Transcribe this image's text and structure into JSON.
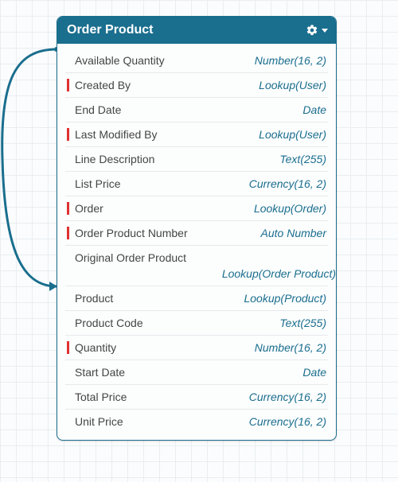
{
  "panel": {
    "title": "Order Product"
  },
  "fields": [
    {
      "name": "Available Quantity",
      "type": "Number(16, 2)",
      "required": false,
      "wrap": false
    },
    {
      "name": "Created By",
      "type": "Lookup(User)",
      "required": true,
      "wrap": false
    },
    {
      "name": "End Date",
      "type": "Date",
      "required": false,
      "wrap": false
    },
    {
      "name": "Last Modified By",
      "type": "Lookup(User)",
      "required": true,
      "wrap": false
    },
    {
      "name": "Line Description",
      "type": "Text(255)",
      "required": false,
      "wrap": false
    },
    {
      "name": "List Price",
      "type": "Currency(16, 2)",
      "required": false,
      "wrap": false
    },
    {
      "name": "Order",
      "type": "Lookup(Order)",
      "required": true,
      "wrap": false
    },
    {
      "name": "Order Product Number",
      "type": "Auto Number",
      "required": true,
      "wrap": false
    },
    {
      "name": "Original Order Product",
      "type": "Lookup(Order Product)",
      "required": false,
      "wrap": true
    },
    {
      "name": "Product",
      "type": "Lookup(Product)",
      "required": false,
      "wrap": false
    },
    {
      "name": "Product Code",
      "type": "Text(255)",
      "required": false,
      "wrap": false
    },
    {
      "name": "Quantity",
      "type": "Number(16, 2)",
      "required": true,
      "wrap": false
    },
    {
      "name": "Start Date",
      "type": "Date",
      "required": false,
      "wrap": false
    },
    {
      "name": "Total Price",
      "type": "Currency(16, 2)",
      "required": false,
      "wrap": false
    },
    {
      "name": "Unit Price",
      "type": "Currency(16, 2)",
      "required": false,
      "wrap": false
    }
  ],
  "colors": {
    "accent": "#1a6e8e",
    "required_marker": "#e03131"
  }
}
